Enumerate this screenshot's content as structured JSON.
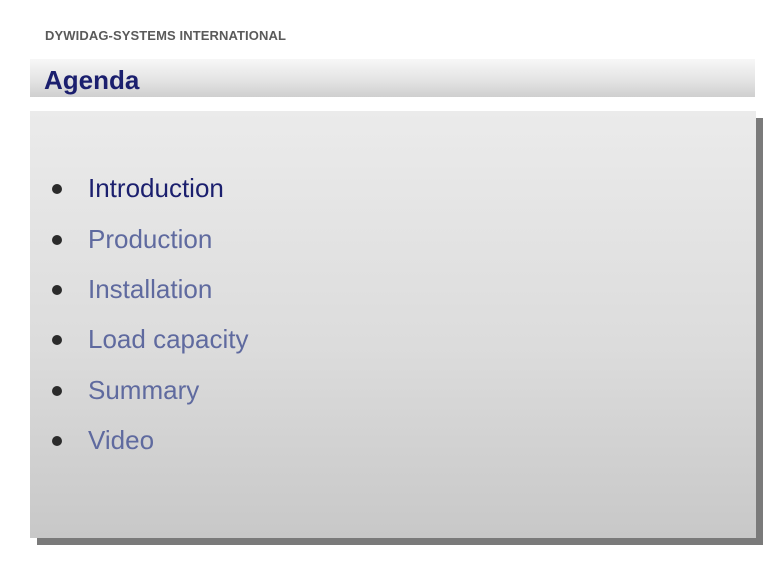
{
  "header": {
    "company": "DYWIDAG-SYSTEMS INTERNATIONAL",
    "title": "Agenda"
  },
  "agenda": {
    "items": [
      {
        "label": "Introduction"
      },
      {
        "label": "Production"
      },
      {
        "label": "Installation"
      },
      {
        "label": "Load capacity"
      },
      {
        "label": "Summary"
      },
      {
        "label": "Video"
      }
    ]
  },
  "colors": {
    "title": "#1b1f6e",
    "item_active": "#1b1f6e",
    "item": "#5f6a9f",
    "bullet": "#2b2b2b",
    "company": "#5a5a5a"
  },
  "icons": {
    "bullet": "filled-circle-bullet"
  }
}
